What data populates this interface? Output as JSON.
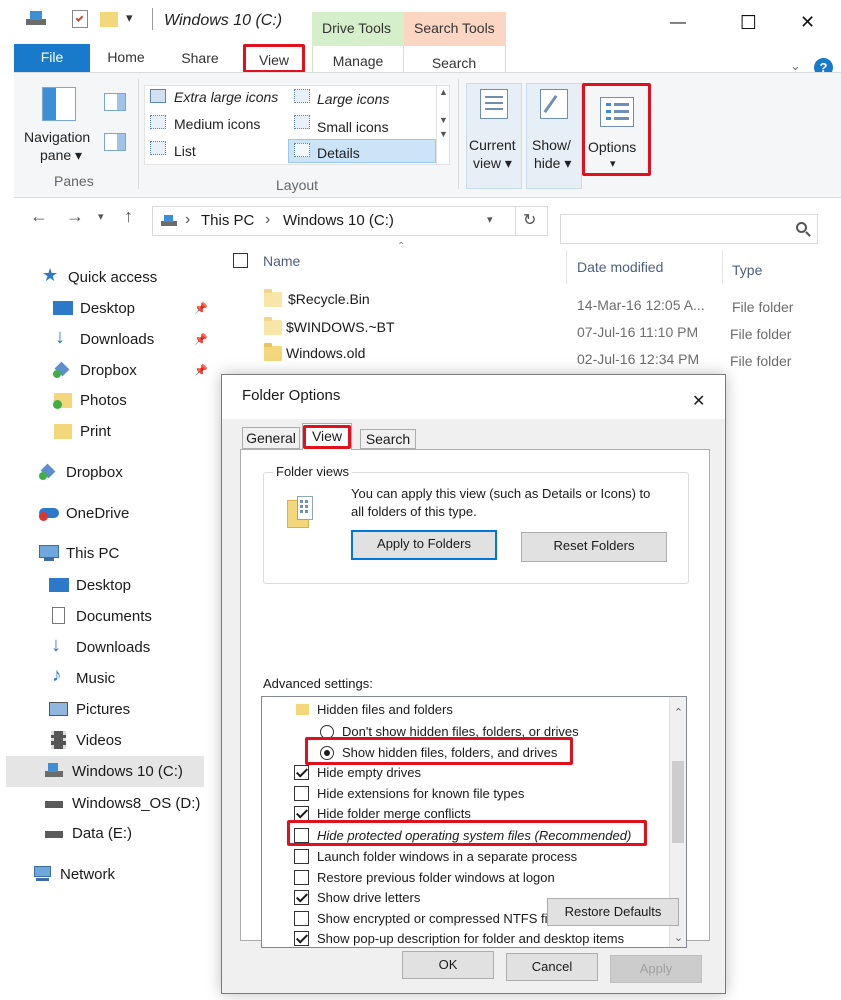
{
  "window": {
    "title": "Windows 10 (C:)",
    "controls": {
      "minimize": "—",
      "maximize": "☐",
      "close": "✕"
    }
  },
  "context_tabs": {
    "drive_tools": "Drive Tools",
    "search_tools": "Search Tools"
  },
  "ribbon_tabs": [
    "File",
    "Home",
    "Share",
    "View",
    "Manage",
    "Search"
  ],
  "ribbon": {
    "panes": {
      "navigation_pane": "Navigation",
      "navigation_pane_2": "pane ▾",
      "group": "Panes"
    },
    "layout": {
      "items": [
        "Extra large icons",
        "Large icons",
        "Medium icons",
        "Small icons",
        "List",
        "Details"
      ],
      "group": "Layout"
    },
    "current_view": {
      "line1": "Current",
      "line2": "view ▾"
    },
    "show_hide": {
      "line1": "Show/",
      "line2": "hide ▾"
    },
    "options": {
      "label": "Options",
      "arrow": "▾"
    }
  },
  "nav": {
    "back": "←",
    "forward": "→",
    "up": "↑",
    "breadcrumb": [
      "This PC",
      "Windows 10 (C:)"
    ],
    "sep": "›"
  },
  "sidebar": {
    "quick_access": "Quick access",
    "quick_items": [
      "Desktop",
      "Downloads",
      "Dropbox",
      "Photos",
      "Print"
    ],
    "dropbox": "Dropbox",
    "onedrive": "OneDrive",
    "this_pc": "This PC",
    "pc_items": [
      "Desktop",
      "Documents",
      "Downloads",
      "Music",
      "Pictures",
      "Videos",
      "Windows 10 (C:)",
      "Windows8_OS (D:)",
      "Data (E:)"
    ],
    "network": "Network"
  },
  "files": {
    "columns": {
      "name": "Name",
      "date": "Date modified",
      "type": "Type"
    },
    "rows": [
      {
        "name": "$Recycle.Bin",
        "date": "14-Mar-16 12:05 A...",
        "type": "File folder"
      },
      {
        "name": "$WINDOWS.~BT",
        "date": "07-Jul-16 11:10 PM",
        "type": "File folder"
      },
      {
        "name": "Windows.old",
        "date": "02-Jul-16 12:34 PM",
        "type": "File folder"
      }
    ]
  },
  "dialog": {
    "title": "Folder Options",
    "close": "✕",
    "tabs": [
      "General",
      "View",
      "Search"
    ],
    "folder_views": {
      "label": "Folder views",
      "description_1": "You can apply this view (such as Details or Icons) to",
      "description_2": "all folders of this type.",
      "apply": "Apply to Folders",
      "reset": "Reset Folders"
    },
    "advanced_label": "Advanced settings:",
    "tree": {
      "group": "Hidden files and folders",
      "radio_1": "Don't show hidden files, folders, or drives",
      "radio_2": "Show hidden files, folders, and drives",
      "checks": [
        {
          "label": "Hide empty drives",
          "checked": true
        },
        {
          "label": "Hide extensions for known file types",
          "checked": false
        },
        {
          "label": "Hide folder merge conflicts",
          "checked": true
        },
        {
          "label": "Hide protected operating system files (Recommended)",
          "checked": false
        },
        {
          "label": "Launch folder windows in a separate process",
          "checked": false
        },
        {
          "label": "Restore previous folder windows at logon",
          "checked": false
        },
        {
          "label": "Show drive letters",
          "checked": true
        },
        {
          "label": "Show encrypted or compressed NTFS files in color",
          "checked": false
        },
        {
          "label": "Show pop-up description for folder and desktop items",
          "checked": true
        }
      ]
    },
    "restore_defaults": "Restore Defaults",
    "ok": "OK",
    "cancel": "Cancel",
    "apply": "Apply"
  },
  "colors": {
    "accent_blue": "#1979ca",
    "highlight_red": "#e0101d",
    "drive_tools_bg": "#d6efcb",
    "search_tools_bg": "#fbd7c3"
  }
}
